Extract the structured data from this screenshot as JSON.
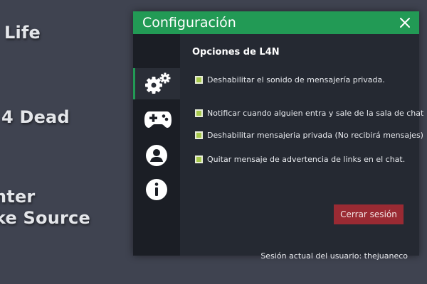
{
  "background": {
    "labels": [
      "Life",
      "4 Dead",
      "nter",
      "ke Source"
    ]
  },
  "dialog": {
    "title": "Configuración",
    "close_icon": "close-icon",
    "sidebar": {
      "items": [
        {
          "icon": "gears-icon",
          "active": true
        },
        {
          "icon": "gamepad-icon",
          "active": false
        },
        {
          "icon": "user-icon",
          "active": false
        },
        {
          "icon": "info-icon",
          "active": false
        }
      ]
    },
    "section_title": "Opciones de L4N",
    "options": [
      {
        "label": "Deshabilitar el sonido de mensajería privada.",
        "checked": false
      },
      {
        "label": "Notificar cuando alguien entra y sale de la sala de chat",
        "checked": false
      },
      {
        "label": "Deshabilitar mensajeria privada (No recibirá mensajes)",
        "checked": false
      },
      {
        "label": "Quitar mensaje de advertencia de links en el chat.",
        "checked": false
      }
    ],
    "logout_label": "Cerrar sesión",
    "session_text": "Sesión actual del usuario: thejuaneco"
  },
  "colors": {
    "accent_green": "#229a55",
    "logout_red": "#9a2a33",
    "checkbox_fill": "#a6c84a"
  }
}
